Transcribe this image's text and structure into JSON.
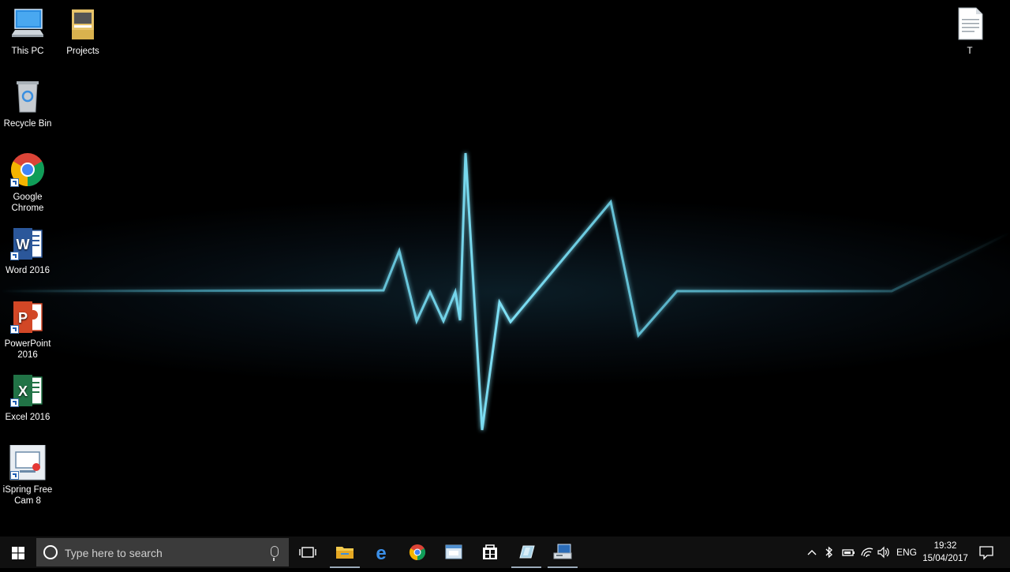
{
  "desktop": {
    "icons": [
      {
        "label": "This PC",
        "icon": "computer-icon"
      },
      {
        "label": "Projects",
        "icon": "folder-icon"
      },
      {
        "label": "Recycle Bin",
        "icon": "recycle-bin-icon"
      },
      {
        "label": "Google Chrome",
        "icon": "chrome-icon"
      },
      {
        "label": "Word 2016",
        "icon": "word-icon"
      },
      {
        "label": "PowerPoint 2016",
        "icon": "powerpoint-icon"
      },
      {
        "label": "Excel 2016",
        "icon": "excel-icon"
      },
      {
        "label": "iSpring Free Cam 8",
        "icon": "ispring-icon"
      },
      {
        "label": "T",
        "icon": "text-document-icon"
      }
    ],
    "wallpaper_color": "#5fd3ee"
  },
  "taskbar": {
    "search_placeholder": "Type here to search",
    "pinned": [
      {
        "name": "task-view-button",
        "icon": "task-view-icon"
      },
      {
        "name": "file-explorer-button",
        "icon": "folder-icon"
      },
      {
        "name": "edge-button",
        "icon": "edge-icon"
      },
      {
        "name": "chrome-button",
        "icon": "chrome-icon"
      },
      {
        "name": "app-button",
        "icon": "window-app-icon"
      },
      {
        "name": "store-button",
        "icon": "store-icon"
      },
      {
        "name": "app2-button",
        "icon": "glass-app-icon"
      },
      {
        "name": "app3-button",
        "icon": "monitor-app-icon"
      }
    ],
    "tray": {
      "language": "ENG",
      "time": "19:32",
      "date": "15/04/2017"
    }
  }
}
